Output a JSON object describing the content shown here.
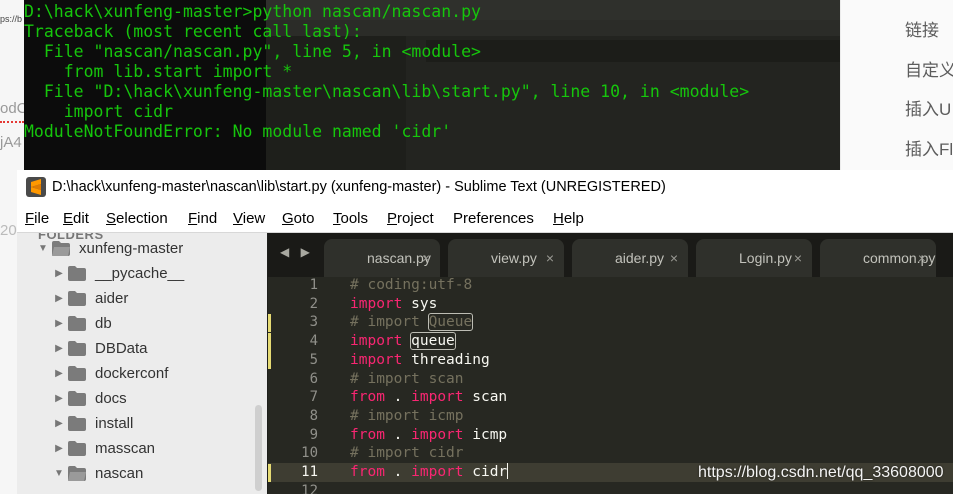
{
  "background": {
    "left_fragments": [
      "ps://b",
      "odCt s",
      "jA4",
      "20"
    ],
    "right_panel_items": [
      "链接",
      "自定义",
      "插入U",
      "插入Fl"
    ]
  },
  "terminal": {
    "text_color": "#16c60c",
    "lines": [
      "D:\\hack\\xunfeng-master>python nascan/nascan.py",
      "Traceback (most recent call last):",
      "  File \"nascan/nascan.py\", line 5, in <module>",
      "    from lib.start import *",
      "  File \"D:\\hack\\xunfeng-master\\nascan\\lib\\start.py\", line 10, in <module>",
      "    import cidr",
      "ModuleNotFoundError: No module named 'cidr'"
    ]
  },
  "window": {
    "title": "D:\\hack\\xunfeng-master\\nascan\\lib\\start.py (xunfeng-master) - Sublime Text (UNREGISTERED)",
    "logo_icon": "sublime-logo-icon",
    "accent": "#ff9800"
  },
  "menu": [
    {
      "mnemonic": "F",
      "rest": "ile"
    },
    {
      "mnemonic": "E",
      "rest": "dit"
    },
    {
      "mnemonic": "S",
      "rest": "election"
    },
    {
      "mnemonic": "F",
      "rest": "ind"
    },
    {
      "mnemonic": "V",
      "rest": "iew"
    },
    {
      "mnemonic": "G",
      "rest": "oto"
    },
    {
      "mnemonic": "T",
      "rest": "ools"
    },
    {
      "mnemonic": "P",
      "rest": "roject"
    },
    {
      "mnemonic": "",
      "rest": "Preferences"
    },
    {
      "mnemonic": "H",
      "rest": "elp"
    }
  ],
  "sidebar": {
    "header": "FOLDERS",
    "items": [
      {
        "label": "xunfeng-master",
        "expanded": true
      },
      {
        "label": "__pycache__",
        "expanded": false
      },
      {
        "label": "aider",
        "expanded": false
      },
      {
        "label": "db",
        "expanded": false
      },
      {
        "label": "DBData",
        "expanded": false
      },
      {
        "label": "dockerconf",
        "expanded": false
      },
      {
        "label": "docs",
        "expanded": false
      },
      {
        "label": "install",
        "expanded": false
      },
      {
        "label": "masscan",
        "expanded": false
      },
      {
        "label": "nascan",
        "expanded": true
      }
    ]
  },
  "tabs": [
    {
      "name": "nascan.py",
      "close": "×"
    },
    {
      "name": "view.py",
      "close": "×"
    },
    {
      "name": "aider.py",
      "close": "×"
    },
    {
      "name": "Login.py",
      "close": "×"
    },
    {
      "name": "common.py",
      "close": "×"
    }
  ],
  "tab_nav": "◀ ▶",
  "editor": {
    "current_line": 11,
    "modified_lines": [
      3,
      4,
      5,
      11
    ],
    "lines": [
      {
        "n": "1",
        "tokens": [
          {
            "t": "cmt",
            "v": "# coding:utf-8"
          }
        ]
      },
      {
        "n": "2",
        "tokens": [
          {
            "t": "kw",
            "v": "import"
          },
          {
            "t": "id",
            "v": " sys"
          }
        ]
      },
      {
        "n": "3",
        "tokens": [
          {
            "t": "cmt",
            "v": "# import "
          },
          {
            "t": "cmt-box",
            "v": "Queue"
          }
        ]
      },
      {
        "n": "4",
        "tokens": [
          {
            "t": "kw",
            "v": "import"
          },
          {
            "t": "id",
            "v": " "
          },
          {
            "t": "id-box",
            "v": "queue"
          }
        ]
      },
      {
        "n": "5",
        "tokens": [
          {
            "t": "kw",
            "v": "import"
          },
          {
            "t": "id",
            "v": " threading"
          }
        ]
      },
      {
        "n": "6",
        "tokens": [
          {
            "t": "cmt",
            "v": "# import scan"
          }
        ]
      },
      {
        "n": "7",
        "tokens": [
          {
            "t": "kw",
            "v": "from"
          },
          {
            "t": "id",
            "v": " . "
          },
          {
            "t": "kw",
            "v": "import"
          },
          {
            "t": "id",
            "v": " scan"
          }
        ]
      },
      {
        "n": "8",
        "tokens": [
          {
            "t": "cmt",
            "v": "# import icmp"
          }
        ]
      },
      {
        "n": "9",
        "tokens": [
          {
            "t": "kw",
            "v": "from"
          },
          {
            "t": "id",
            "v": " . "
          },
          {
            "t": "kw",
            "v": "import"
          },
          {
            "t": "id",
            "v": " icmp"
          }
        ]
      },
      {
        "n": "10",
        "tokens": [
          {
            "t": "cmt",
            "v": "# import cidr"
          }
        ]
      },
      {
        "n": "11",
        "tokens": [
          {
            "t": "kw",
            "v": "from"
          },
          {
            "t": "id",
            "v": " . "
          },
          {
            "t": "kw",
            "v": "import"
          },
          {
            "t": "id",
            "v": " cidr"
          }
        ]
      },
      {
        "n": "12",
        "tokens": []
      }
    ]
  },
  "watermark": "https://blog.csdn.net/qq_33608000"
}
